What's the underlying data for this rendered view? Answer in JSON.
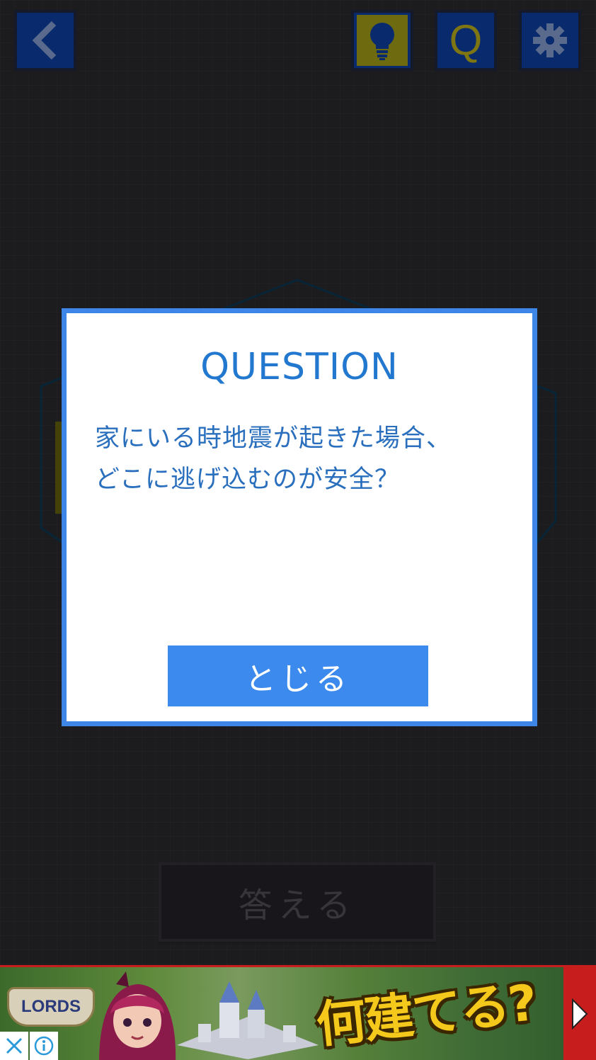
{
  "toolbar": {
    "back_icon": "chevron-left-icon",
    "hint_icon": "lightbulb-icon",
    "question_label": "Q",
    "settings_icon": "gear-icon"
  },
  "modal": {
    "title": "QUESTION",
    "question_text": "家にいる時地震が起きた場合、\nどこに逃げ込むのが安全？",
    "close_label": "とじる"
  },
  "answer_button": {
    "label": "答える"
  },
  "ad": {
    "brand": "LORDS",
    "headline": "何建てる?",
    "arrow_icon": "play-arrow-icon",
    "close_icon": "close-icon",
    "info_icon": "info-icon"
  },
  "colors": {
    "accent": "#3d86e8",
    "text_blue": "#2a6fbe",
    "toolbar_bg": "#0a2a6e",
    "ad_border": "#c81d1d",
    "headline_yellow": "#f5c81c"
  }
}
